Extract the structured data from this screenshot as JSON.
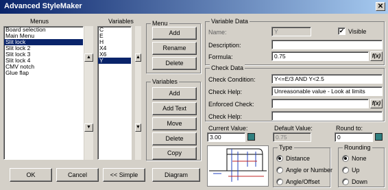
{
  "window": {
    "title": "Advanced StyleMaker",
    "close_glyph": "✕"
  },
  "menus_panel": {
    "header": "Menus",
    "items": [
      "Board selection",
      "Main Menu",
      "Slit lock",
      "Slit lock 2",
      "Slit lock 3",
      "Slit lock 4",
      "CMV notch",
      "Glue flap"
    ],
    "selected_index": 2
  },
  "variables_panel": {
    "header": "Variables",
    "items": [
      "C",
      "E",
      "H",
      "X4",
      "X6",
      "Y"
    ],
    "selected_index": 5
  },
  "menu_group": {
    "title": "Menu",
    "add": "Add",
    "rename": "Rename",
    "delete": "Delete"
  },
  "variables_group": {
    "title": "Variables",
    "add": "Add",
    "add_text": "Add Text",
    "move": "Move",
    "delete": "Delete",
    "copy": "Copy"
  },
  "variable_data": {
    "title": "Variable Data",
    "name_label": "Name:",
    "name_value": "Y",
    "visible_label": "Visible",
    "visible_checked": true,
    "description_label": "Description:",
    "description_value": "",
    "formula_label": "Formula:",
    "formula_value": "0.75",
    "fx_label": "f(x)"
  },
  "check_data": {
    "title": "Check Data",
    "condition_label": "Check Condition:",
    "condition_value": "Y<=E/3 AND Y<2.5",
    "help_label": "Check Help:",
    "help_value": "Unreasonable value - Look at limits",
    "enforced_label": "Enforced Check:",
    "enforced_value": "",
    "help2_label": "Check Help:",
    "help2_value": "",
    "fx_label": "f(x)"
  },
  "values": {
    "current_label": "Current Value:",
    "current_value": "3.00",
    "default_label": "Default Value:",
    "default_value": "0.75",
    "round_label": "Round to:",
    "round_value": "0"
  },
  "type_group": {
    "title": "Type",
    "options": [
      "Distance",
      "Angle or Number",
      "Angle/Offset"
    ],
    "selected_index": 0
  },
  "rounding_group": {
    "title": "Rounding",
    "options": [
      "None",
      "Up",
      "Down"
    ],
    "selected_index": 0
  },
  "footer": {
    "ok": "OK",
    "cancel": "Cancel",
    "simple": "<< Simple",
    "diagram": "Diagram"
  }
}
